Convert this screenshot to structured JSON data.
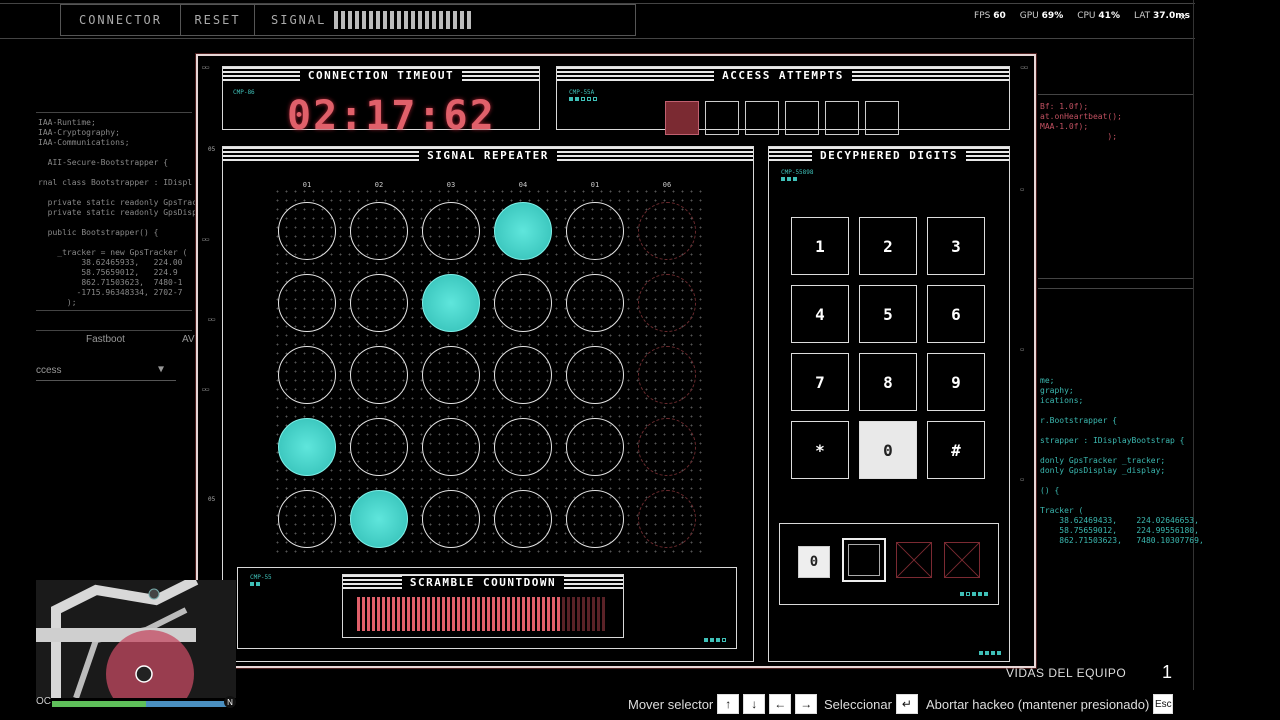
{
  "topmenu": {
    "tabs": [
      "CONNECTOR",
      "RESET",
      "SIGNAL"
    ],
    "signal_bars": 20
  },
  "stats": {
    "fps_label": "FPS",
    "fps": "60",
    "gpu_label": "GPU",
    "gpu": "69",
    "cpu_label": "CPU",
    "cpu": "41",
    "lat_label": "LAT",
    "lat": "37.0"
  },
  "background": {
    "left_code": "IAA-Runtime;\nIAA-Cryptography;\nIAA-Communications;\n\n  AII-Secure-Bootstrapper {\n\nrnal class Bootstrapper : IDispl\n\n  private static readonly GpsTrack\n  private static readonly GpsDispl\n\n  public Bootstrapper() {\n\n    _tracker = new GpsTracker (\n         38.62465933,   224.00\n         58.75659012,   224.9\n         862.71503623,  7480-1\n        -1715.96348334, 2702-7\n      );",
    "left_menu_item": "Fastboot",
    "left_menu_item2": "AV",
    "left_dropdown": "ccess",
    "right_code_top": "Bf: 1.0f);\nat.onHeartbeat();\nMAA-1.0f);\n              );",
    "right_code_bottom": "me;\ngraphy;\nications;\n\nr.Bootstrapper {\n\nstrapper : IDisplayBootstrap {\n\ndonly GpsTracker _tracker;\ndonly GpsDisplay _display;\n\n() {\n\nTracker (\n    38.62469433,    224.02646653,\n    58.75659012,    224.99556180,\n    862.71503623,   7480.10307769,"
  },
  "timeout": {
    "title": "CONNECTION TIMEOUT",
    "code": "CMP-86",
    "time": "02:17:62"
  },
  "attempts": {
    "title": "ACCESS ATTEMPTS",
    "code": "CMP-55A",
    "total": 6,
    "used": 1
  },
  "repeater": {
    "title": "SIGNAL REPEATER",
    "columns": [
      "01",
      "02",
      "03",
      "04",
      "01",
      "06"
    ],
    "grid": [
      [
        0,
        0,
        0,
        1,
        0,
        2
      ],
      [
        0,
        0,
        1,
        0,
        0,
        2
      ],
      [
        0,
        0,
        0,
        0,
        0,
        2
      ],
      [
        1,
        0,
        0,
        0,
        0,
        2
      ],
      [
        0,
        1,
        0,
        0,
        0,
        2
      ]
    ],
    "scramble": {
      "title": "SCRAMBLE COUNTDOWN",
      "code": "CMP-55",
      "bars_total": 50,
      "bars_active": 41
    }
  },
  "digits": {
    "title": "DECYPHERED DIGITS",
    "code": "CMP-55898",
    "keys": [
      "1",
      "2",
      "3",
      "4",
      "5",
      "6",
      "7",
      "8",
      "9",
      "*",
      "0",
      "#"
    ],
    "selected_key": "0",
    "entered": [
      "0"
    ],
    "slots_total": 4
  },
  "colors": {
    "accent_cyan": "#3ec9c0",
    "accent_red": "#e0606a",
    "panel_border": "#e7d6d6"
  },
  "hud": {
    "lives_label": "VIDAS DEL EQUIPO",
    "lives": "1",
    "hint_move": "Mover selector",
    "hint_select": "Seleccionar",
    "hint_abort": "Abortar hackeo (mantener presionado)",
    "key_esc": "Esc",
    "compass_n": "N",
    "compass_oc": "OC"
  }
}
